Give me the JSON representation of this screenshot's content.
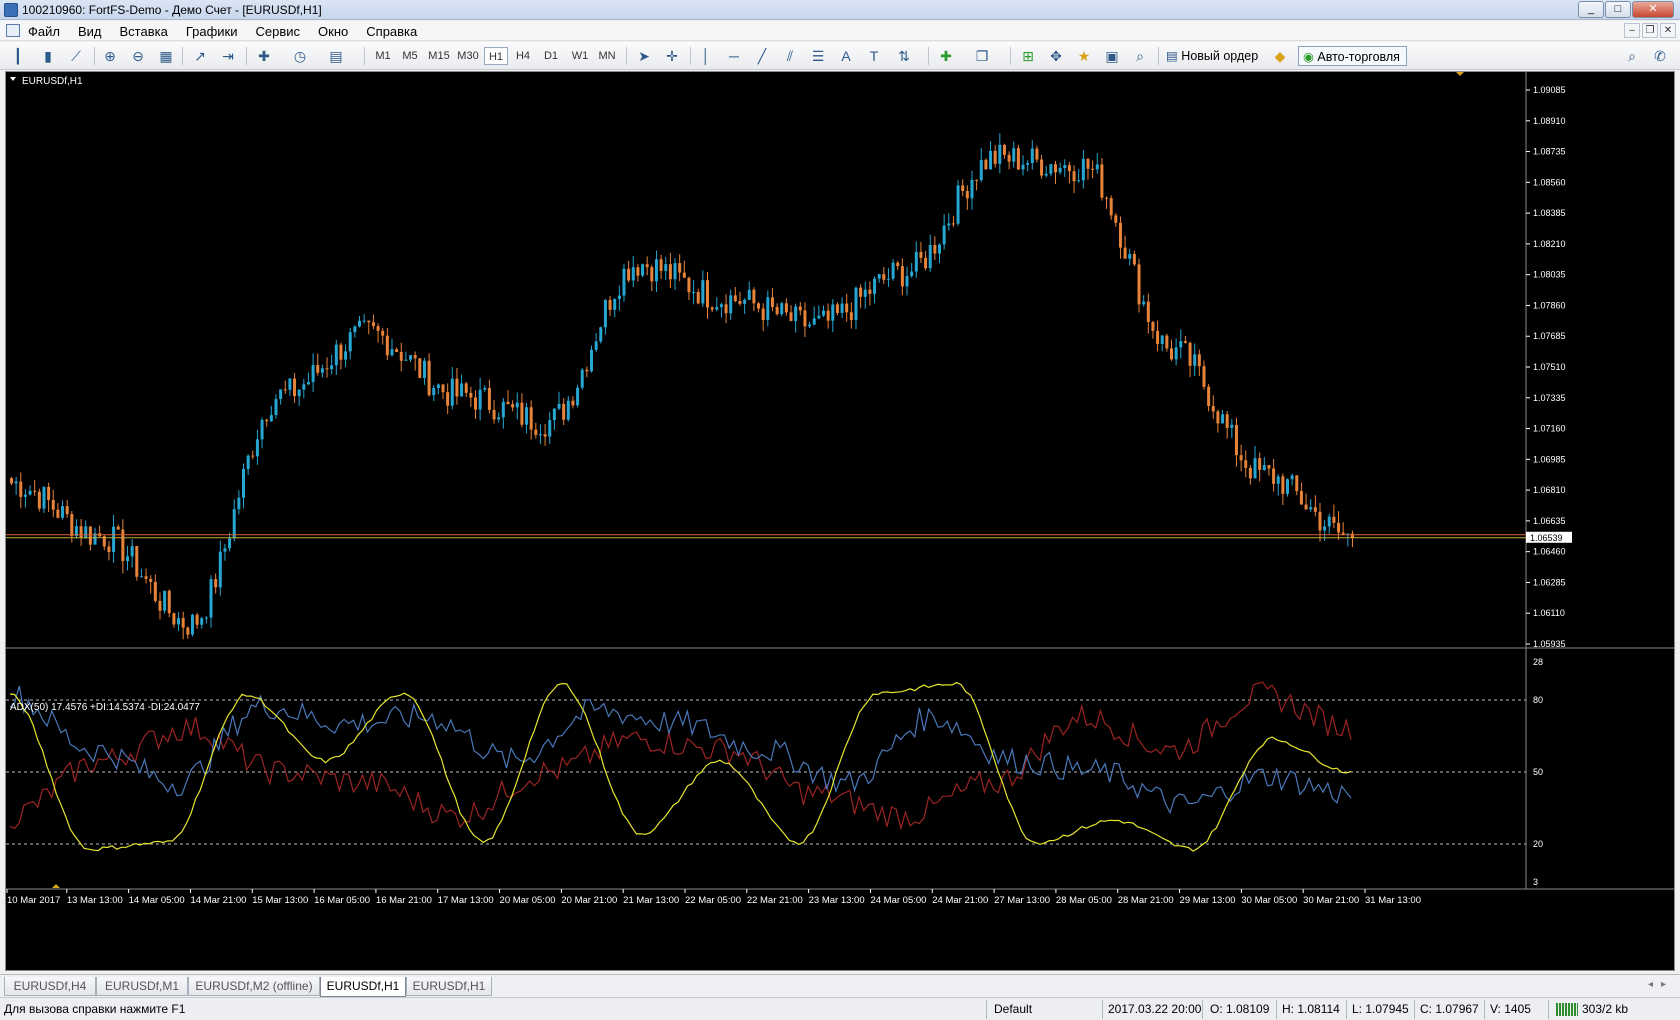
{
  "window": {
    "title": "100210960: FortFS-Demo - Демо Счет - [EURUSDf,H1]",
    "buttons": [
      "_",
      "□",
      "✕"
    ]
  },
  "menu": {
    "items": [
      {
        "label": "Файл"
      },
      {
        "label": "Вид"
      },
      {
        "label": "Вставка"
      },
      {
        "label": "Графики"
      },
      {
        "label": "Сервис"
      },
      {
        "label": "Окно"
      },
      {
        "label": "Справка"
      }
    ],
    "mdi_buttons": [
      "–",
      "❐",
      "✕"
    ]
  },
  "toolbar": {
    "timeframes": [
      "M1",
      "M5",
      "M15",
      "M30",
      "H1",
      "H4",
      "D1",
      "W1",
      "MN"
    ],
    "active_timeframe": "H1",
    "new_order_label": "Новый ордер",
    "autotrade_label": "Авто-торговля"
  },
  "chart": {
    "symbol_label": "EURUSDf,H1",
    "indicator_label": "ADX(50) 17.4576 +DI:14.5374 -DI:24.0477",
    "price_labels": [
      "1.09085",
      "1.08910",
      "1.08735",
      "1.08560",
      "1.08385",
      "1.08210",
      "1.08035",
      "1.07860",
      "1.07685",
      "1.07510",
      "1.07335",
      "1.07160",
      "1.06985",
      "1.06810",
      "1.06635",
      "1.06460",
      "1.06285",
      "1.06110",
      "1.05935"
    ],
    "current_price": "1.06539",
    "indicator_levels": [
      "28",
      "80",
      "50",
      "20",
      "3"
    ],
    "time_labels": [
      "10 Mar 2017",
      "13 Mar 13:00",
      "14 Mar 05:00",
      "14 Mar 21:00",
      "15 Mar 13:00",
      "16 Mar 05:00",
      "16 Mar 21:00",
      "17 Mar 13:00",
      "20 Mar 05:00",
      "20 Mar 21:00",
      "21 Mar 13:00",
      "22 Mar 05:00",
      "22 Mar 21:00",
      "23 Mar 13:00",
      "24 Mar 05:00",
      "24 Mar 21:00",
      "27 Mar 13:00",
      "28 Mar 05:00",
      "28 Mar 21:00",
      "29 Mar 13:00",
      "30 Mar 05:00",
      "30 Mar 21:00",
      "31 Mar 13:00"
    ],
    "colors": {
      "bull": "#26a6d1",
      "bear": "#e8843a",
      "adx": "#e6e62e",
      "plus_di": "#4a78b8",
      "minus_di": "#9c2424",
      "price_line": "#d8632a"
    }
  },
  "chart_data": {
    "type": "line",
    "title": "EURUSDf,H1",
    "price_range": [
      1.05935,
      1.09085
    ],
    "series": [
      {
        "name": "EURUSDf",
        "x": [
          "10 Mar",
          "13 Mar",
          "14 Mar",
          "15 Mar",
          "16 Mar",
          "17 Mar",
          "20 Mar",
          "21 Mar",
          "22 Mar",
          "23 Mar",
          "24 Mar",
          "27 Mar",
          "28 Mar",
          "29 Mar",
          "30 Mar",
          "31 Mar"
        ],
        "values": [
          1.0685,
          1.0655,
          1.0605,
          1.0735,
          1.077,
          1.0735,
          1.072,
          1.081,
          1.079,
          1.0775,
          1.0805,
          1.087,
          1.0865,
          1.076,
          1.069,
          1.0654
        ]
      },
      {
        "name": "ADX(50)",
        "values": [
          85,
          15,
          18,
          85,
          55,
          86,
          18,
          90,
          22,
          55,
          18,
          86,
          90,
          18,
          28,
          15,
          65,
          50
        ]
      },
      {
        "name": "+DI",
        "values": [
          85,
          60,
          45,
          80,
          72,
          75,
          55,
          78,
          72,
          60,
          45,
          75,
          55,
          50,
          35,
          48,
          40
        ]
      },
      {
        "name": "-DI",
        "values": [
          30,
          55,
          70,
          50,
          45,
          30,
          50,
          65,
          60,
          40,
          30,
          45,
          75,
          60,
          85,
          70
        ]
      }
    ],
    "indicator_range": [
      3,
      28
    ]
  },
  "tabs": [
    {
      "label": "EURUSDf,H4"
    },
    {
      "label": "EURUSDf,M1"
    },
    {
      "label": "EURUSDf,M2 (offline)"
    },
    {
      "label": "EURUSDf,H1"
    },
    {
      "label": "EURUSDf,H1"
    }
  ],
  "active_tab_index": 3,
  "status": {
    "help": "Для вызова справки нажмите F1",
    "profile": "Default",
    "datetime": "2017.03.22 20:00",
    "open": "O: 1.08109",
    "high": "H: 1.08114",
    "low": "L: 1.07945",
    "close": "C: 1.07967",
    "volume": "V: 1405",
    "traffic": "303/2 kb"
  }
}
